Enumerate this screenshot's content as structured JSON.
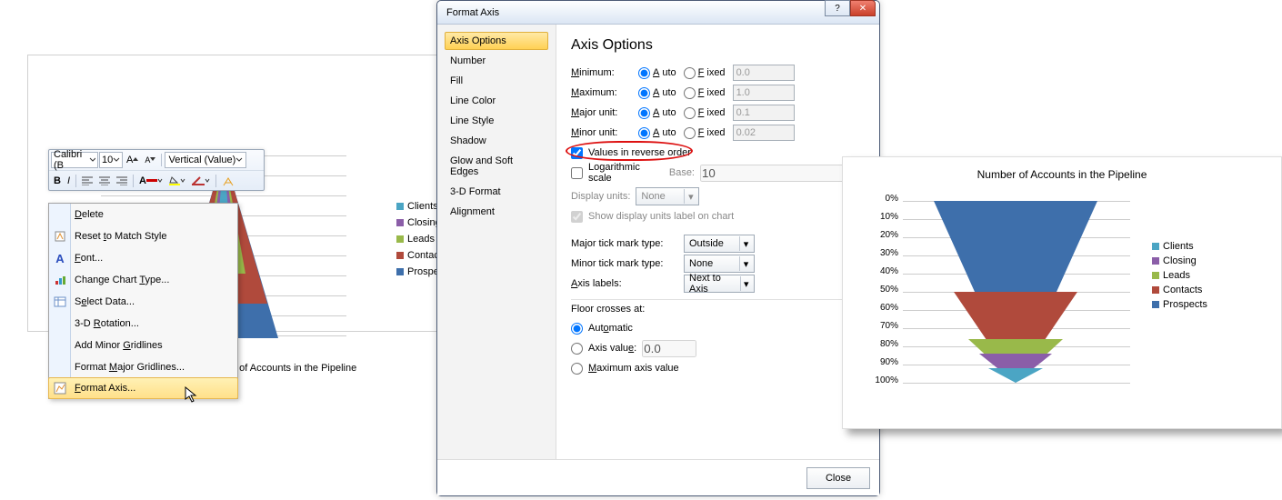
{
  "chart_data": [
    {
      "type": "pyramid-stacked",
      "title": "Number of Accounts in the Pipeline",
      "series": [
        {
          "name": "Clients",
          "color": "#4ba5c4",
          "value": 8
        },
        {
          "name": "Closing",
          "color": "#8b5ea8",
          "value": 8
        },
        {
          "name": "Leads",
          "color": "#99b94a",
          "value": 8
        },
        {
          "name": "Contacts",
          "color": "#b04a3c",
          "value": 16
        },
        {
          "name": "Prospects",
          "color": "#3e6fab",
          "value": 60
        }
      ],
      "ylim": [
        0,
        100
      ],
      "y_ticks": [
        "100%",
        "90%",
        "80%",
        "70%",
        "60%",
        "50%",
        "40%",
        "30%",
        "20%",
        "10%"
      ],
      "reversed": false
    },
    {
      "type": "pyramid-stacked",
      "title": "Number of Accounts in the Pipeline",
      "series": [
        {
          "name": "Clients",
          "color": "#4ba5c4",
          "value": 8
        },
        {
          "name": "Closing",
          "color": "#8b5ea8",
          "value": 8
        },
        {
          "name": "Leads",
          "color": "#99b94a",
          "value": 8
        },
        {
          "name": "Contacts",
          "color": "#b04a3c",
          "value": 16
        },
        {
          "name": "Prospects",
          "color": "#3e6fab",
          "value": 60
        }
      ],
      "ylim": [
        0,
        100
      ],
      "y_ticks": [
        "0%",
        "10%",
        "20%",
        "30%",
        "40%",
        "50%",
        "60%",
        "70%",
        "80%",
        "90%",
        "100%"
      ],
      "reversed": true
    }
  ],
  "legend_items": [
    {
      "label": "Clients",
      "color": "#4ba5c4"
    },
    {
      "label": "Closing",
      "color": "#8b5ea8"
    },
    {
      "label": "Leads",
      "color": "#99b94a"
    },
    {
      "label": "Contacts",
      "color": "#b04a3c"
    },
    {
      "label": "Prospects",
      "color": "#3e6fab"
    }
  ],
  "mini_toolbar": {
    "font_name": "Calibri (B",
    "font_size": "10",
    "target_combo": "Vertical (Value)"
  },
  "context_menu": {
    "items": [
      {
        "label": "Delete",
        "u": 0
      },
      {
        "label": "Reset to Match Style",
        "u": 6
      },
      {
        "label": "Font...",
        "u": 0
      },
      {
        "label": "Change Chart Type...",
        "u": 13
      },
      {
        "label": "Select Data...",
        "u": 1
      },
      {
        "label": "3-D Rotation...",
        "u": 4
      },
      {
        "label": "Add Minor Gridlines",
        "u": 10
      },
      {
        "label": "Format Major Gridlines...",
        "u": 7
      },
      {
        "label": "Format Axis...",
        "u": 0,
        "highlight": true
      }
    ]
  },
  "dialog": {
    "title": "Format Axis",
    "left_tabs": [
      "Axis Options",
      "Number",
      "Fill",
      "Line Color",
      "Line Style",
      "Shadow",
      "Glow and Soft Edges",
      "3-D Format",
      "Alignment"
    ],
    "heading": "Axis Options",
    "bounds": [
      {
        "label": "Minimum:",
        "auto": true,
        "fixed": false,
        "value": "0.0"
      },
      {
        "label": "Maximum:",
        "auto": true,
        "fixed": false,
        "value": "1.0"
      },
      {
        "label": "Major unit:",
        "auto": true,
        "fixed": false,
        "value": "0.1"
      },
      {
        "label": "Minor unit:",
        "auto": true,
        "fixed": false,
        "value": "0.02"
      }
    ],
    "auto_label": "Auto",
    "fixed_label": "Fixed",
    "reverse": {
      "label": "Values in reverse order",
      "checked": true
    },
    "log": {
      "label": "Logarithmic scale",
      "checked": false,
      "base_lbl": "Base:",
      "base_val": "10"
    },
    "display_units": {
      "label": "Display units:",
      "value": "None",
      "show_label": "Show display units label on chart"
    },
    "major_tick": {
      "label": "Major tick mark type:",
      "value": "Outside"
    },
    "minor_tick": {
      "label": "Minor tick mark type:",
      "value": "None"
    },
    "axis_labels": {
      "label": "Axis labels:",
      "value": "Next to Axis"
    },
    "floor": {
      "label": "Floor crosses at:",
      "automatic": "Automatic",
      "axis_value": "Axis value:",
      "axis_value_val": "0.0",
      "max": "Maximum axis value",
      "selected": "automatic"
    },
    "close_btn": "Close"
  }
}
